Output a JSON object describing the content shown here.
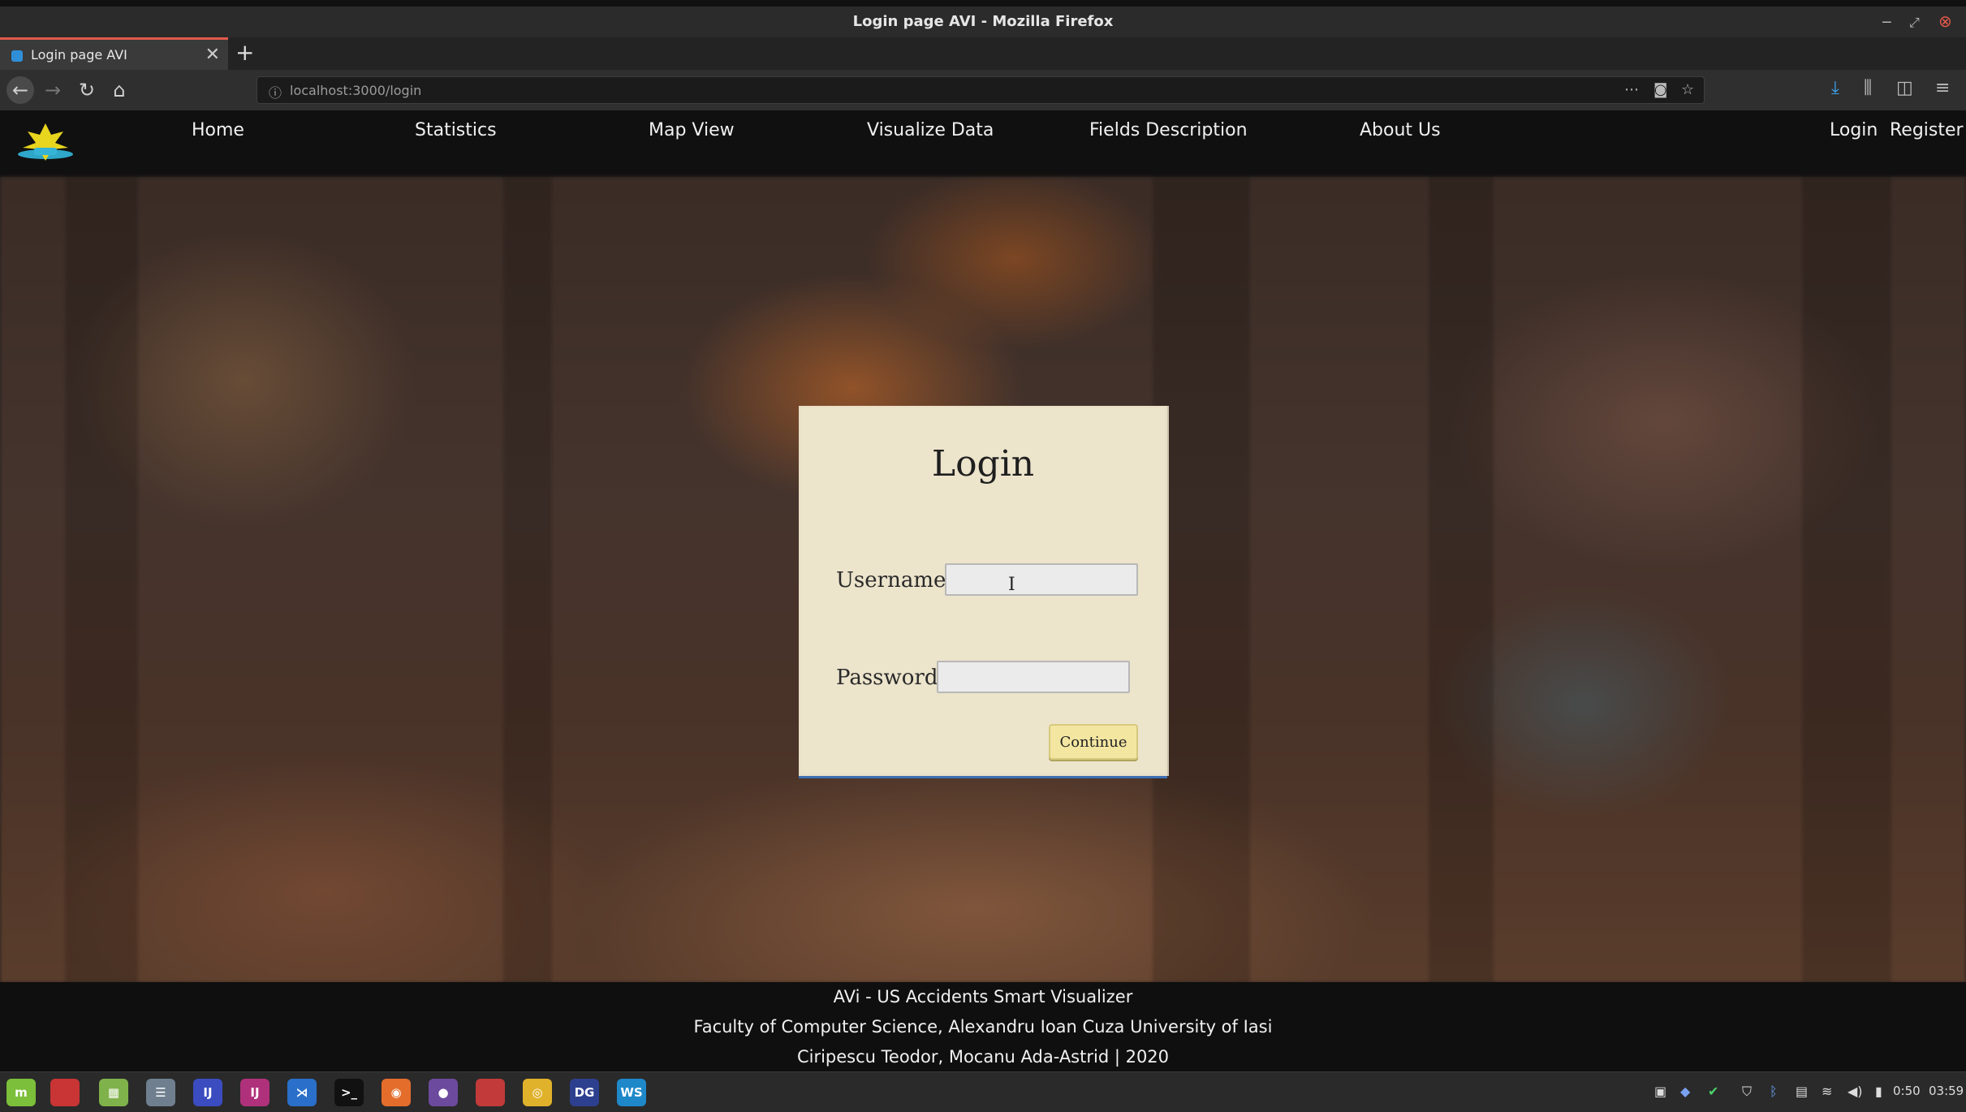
{
  "window": {
    "title": "Login page AVI - Mozilla Firefox"
  },
  "tab": {
    "label": "Login page AVI",
    "close": "✕",
    "new_tab": "+"
  },
  "urlbar": {
    "url": "localhost:3000/login"
  },
  "site_nav": {
    "links": [
      "Home",
      "Statistics",
      "Map View",
      "Visualize Data",
      "Fields Description",
      "About Us"
    ],
    "auth": [
      "Login",
      "Register"
    ]
  },
  "login_form": {
    "heading": "Login",
    "username_label": "Username:",
    "username_value": "",
    "password_label": "Password:",
    "password_value": "",
    "submit_label": "Continue"
  },
  "footer": {
    "line1": "AVi - US Accidents Smart Visualizer",
    "line2": "Faculty of Computer Science, Alexandru Ioan Cuza University of Iasi",
    "line3": "Ciripescu Teodor, Mocanu Ada-Astrid | 2020"
  },
  "taskbar": {
    "apps": [
      "menu-icon",
      "files-icon",
      "calculator-icon",
      "settings-icon",
      "intellij-icon",
      "intellij-icon",
      "vscode-icon",
      "terminal-icon",
      "firefox-icon",
      "github-icon",
      "folder-icon",
      "chrome-icon",
      "datagrip-icon",
      "webstorm-icon"
    ],
    "app_labels": {
      "intellij": "IJ",
      "datagrip": "DG",
      "webstorm": "WS",
      "terminal": ">_"
    },
    "battery_time": "0:50",
    "clock": "03:59"
  },
  "colors": {
    "card_bg": "#ece4cb",
    "button_bg": "#f3e6a1",
    "header_bg": "#101010",
    "card_shadow": "#3d6fb3",
    "tab_accent": "#e0584a"
  }
}
